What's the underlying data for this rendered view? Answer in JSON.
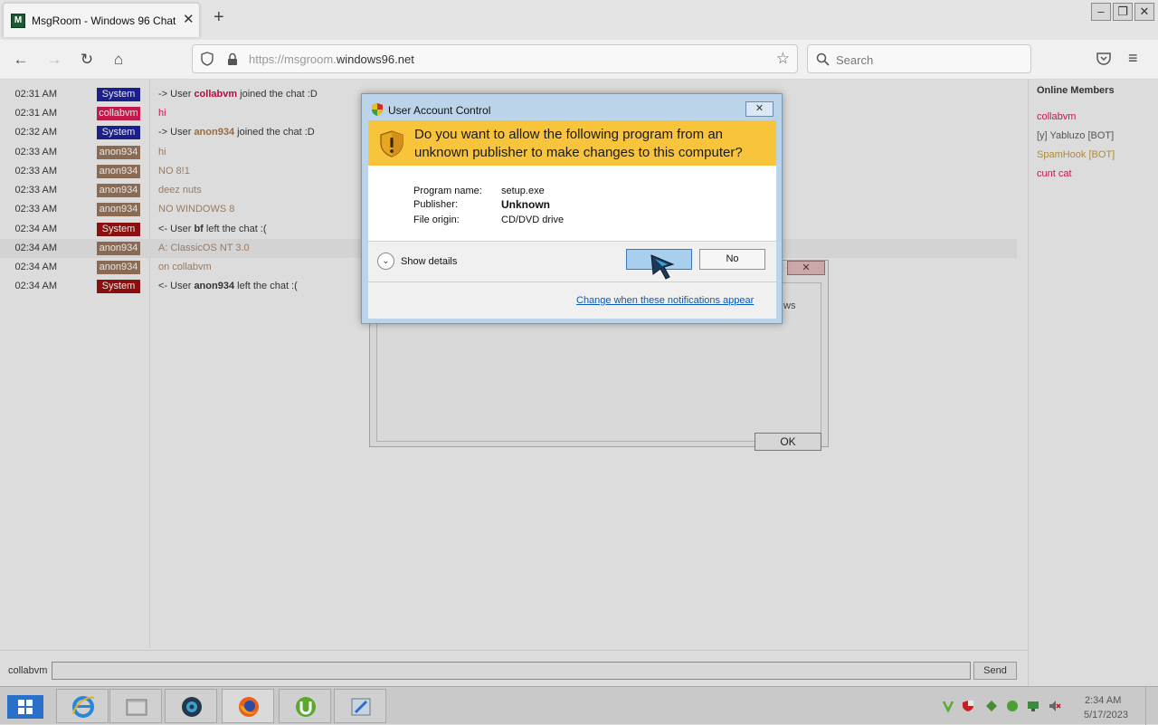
{
  "browser": {
    "tab_title": "MsgRoom - Windows 96 Chat",
    "tab_close": "✕",
    "new_tab": "+",
    "url_prefix": "https://msgroom.",
    "url_host": "windows96.net",
    "search_placeholder": "Search"
  },
  "chat": {
    "messages": [
      {
        "time": "02:31 AM",
        "user": "System",
        "badge_color": "#1b1f8c",
        "text_pre": "-> User ",
        "bold": "collabvm",
        "bold_color": "#b01040",
        "text_post": " joined the chat :D",
        "text_color": "#333333"
      },
      {
        "time": "02:31 AM",
        "user": "collabvm",
        "badge_color": "#c2184a",
        "text_pre": "",
        "bold": "",
        "bold_color": "",
        "text_post": "hi",
        "text_color": "#c2184a"
      },
      {
        "time": "02:32 AM",
        "user": "System",
        "badge_color": "#1b1f8c",
        "text_pre": "-> User ",
        "bold": "anon934",
        "bold_color": "#9a6a40",
        "text_post": " joined the chat :D",
        "text_color": "#333333"
      },
      {
        "time": "02:33 AM",
        "user": "anon934",
        "badge_color": "#8a6a52",
        "text_pre": "",
        "bold": "",
        "bold_color": "",
        "text_post": "hi",
        "text_color": "#9a7a62"
      },
      {
        "time": "02:33 AM",
        "user": "anon934",
        "badge_color": "#8a6a52",
        "text_pre": "",
        "bold": "",
        "bold_color": "",
        "text_post": "NO 8!1",
        "text_color": "#9a7a62"
      },
      {
        "time": "02:33 AM",
        "user": "anon934",
        "badge_color": "#8a6a52",
        "text_pre": "",
        "bold": "",
        "bold_color": "",
        "text_post": "deez nuts",
        "text_color": "#9a7a62"
      },
      {
        "time": "02:33 AM",
        "user": "anon934",
        "badge_color": "#8a6a52",
        "text_pre": "",
        "bold": "",
        "bold_color": "",
        "text_post": "NO WINDOWS 8",
        "text_color": "#9a7a62"
      },
      {
        "time": "02:34 AM",
        "user": "System",
        "badge_color": "#8a1010",
        "text_pre": "<- User ",
        "bold": "bf",
        "bold_color": "#333333",
        "text_post": " left the chat :(",
        "text_color": "#333333"
      },
      {
        "time": "02:34 AM",
        "user": "anon934",
        "badge_color": "#8a6a52",
        "text_pre": "",
        "bold": "",
        "bold_color": "",
        "text_post": "A: ClassicOS NT 3.0",
        "text_color": "#9a7a62",
        "highlight": true
      },
      {
        "time": "02:34 AM",
        "user": "anon934",
        "badge_color": "#8a6a52",
        "text_pre": "",
        "bold": "",
        "bold_color": "",
        "text_post": "on collabvm",
        "text_color": "#9a7a62"
      },
      {
        "time": "02:34 AM",
        "user": "System",
        "badge_color": "#8a1010",
        "text_pre": "<- User ",
        "bold": "anon934",
        "bold_color": "#333333",
        "text_post": " left the chat :(",
        "text_color": "#333333"
      }
    ],
    "input_label": "collabvm",
    "input_value": "",
    "send_label": "Send"
  },
  "members": {
    "title": "Online Members",
    "list": [
      {
        "name": "collabvm",
        "color": "#c2184a"
      },
      {
        "name": "[y] Yabluzo [BOT]",
        "color": "#555555"
      },
      {
        "name": "SpamHook [BOT]",
        "color": "#b08a30"
      },
      {
        "name": "cunt cat",
        "color": "#c2184a"
      }
    ]
  },
  "bg_dialog": {
    "close": "✕",
    "ok_label": "OK",
    "partial_text": "ws"
  },
  "uac": {
    "title": "User Account Control",
    "close": "✕",
    "question": "Do you want to allow the following program from an unknown publisher to make changes to this computer?",
    "program_name_label": "Program name:",
    "program_name": "setup.exe",
    "publisher_label": "Publisher:",
    "publisher": "Unknown",
    "origin_label": "File origin:",
    "origin": "CD/DVD drive",
    "show_details": "Show details",
    "yes_label": "",
    "no_label": "No",
    "change_link": "Change when these notifications appear"
  },
  "taskbar": {
    "items": [
      "ie-icon",
      "explorer-icon",
      "media-center-icon",
      "firefox-icon",
      "utorrent-icon",
      "installer-icon"
    ],
    "time": "2:34 AM",
    "date": "5/17/2023"
  },
  "colors": {
    "uac_header": "#f8c43c",
    "link": "#0b59b4",
    "yes_button": "#a8cfee"
  }
}
